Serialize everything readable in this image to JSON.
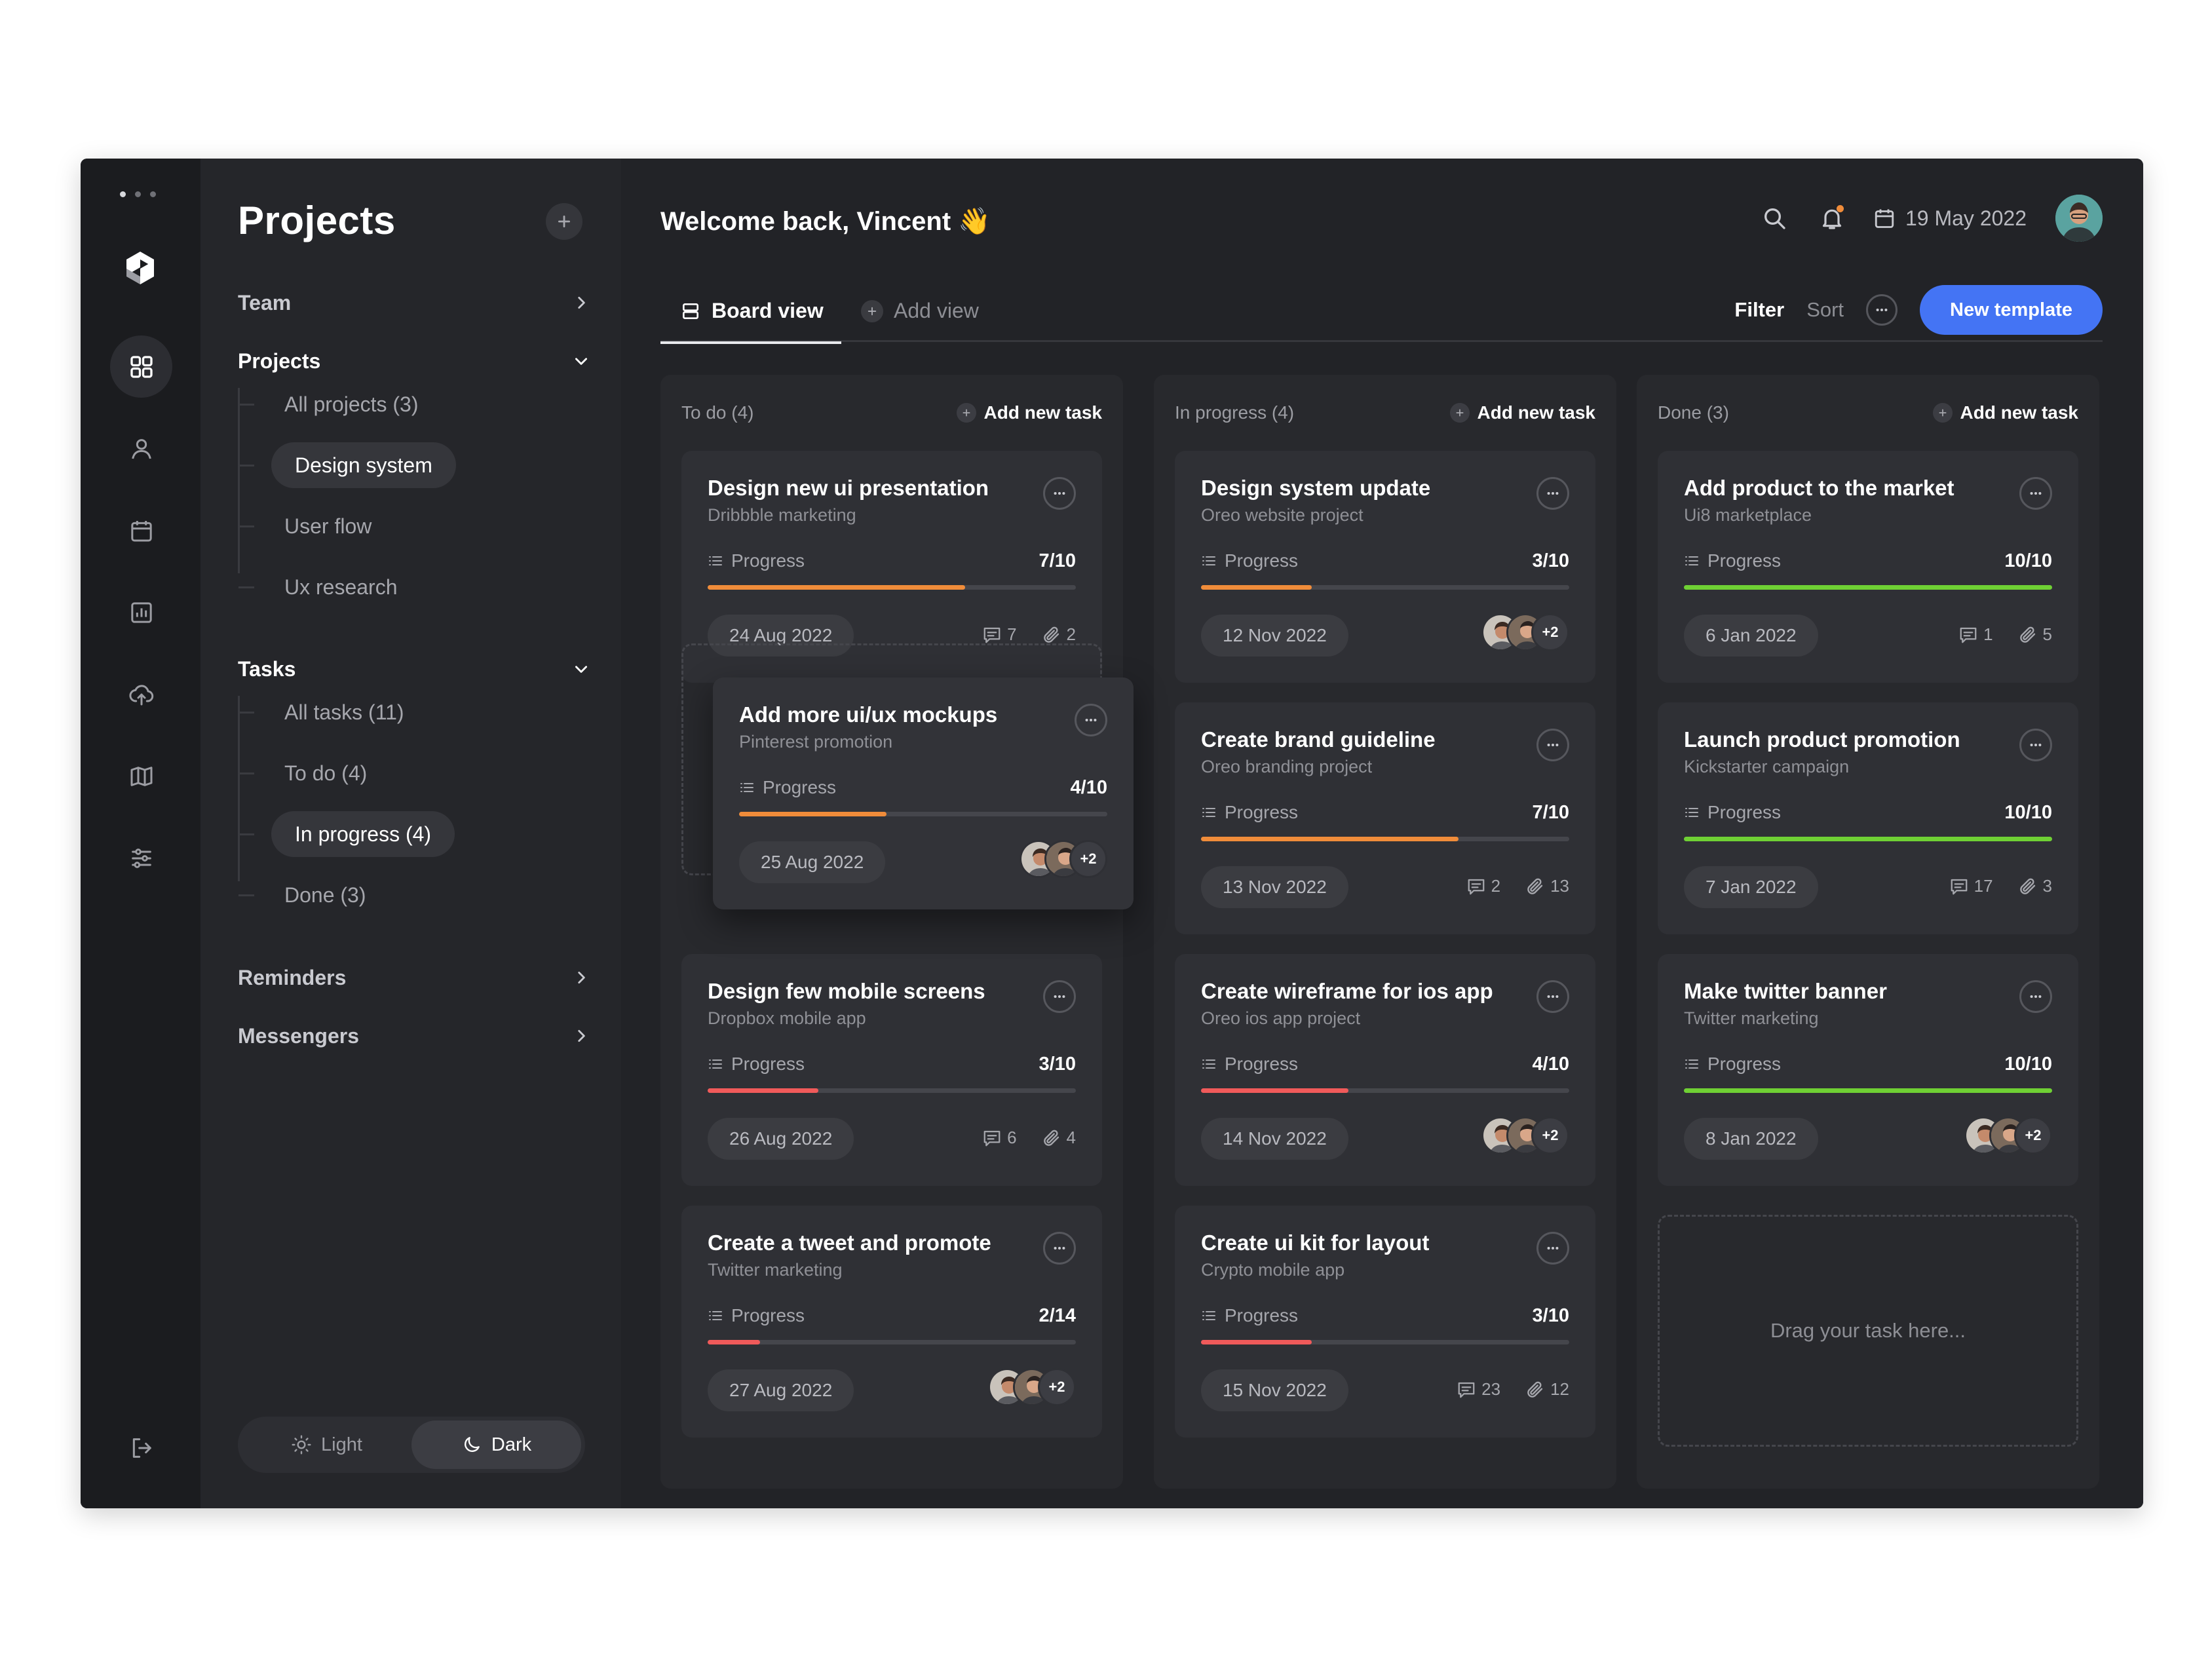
{
  "app": {
    "title": "Projects"
  },
  "colors": {
    "accent": "#4474f4",
    "orange": "#f08c3a",
    "red": "#f05a5a",
    "green": "#6fd034"
  },
  "sidebar": {
    "title": "Projects",
    "sections": {
      "team": "Team",
      "projects": "Projects",
      "tasks": "Tasks",
      "reminders": "Reminders",
      "messengers": "Messengers"
    },
    "project_items": [
      "All projects (3)",
      "Design system",
      "User flow",
      "Ux research"
    ],
    "task_items": [
      "All tasks (11)",
      "To do (4)",
      "In progress (4)",
      "Done (3)"
    ],
    "theme": {
      "light": "Light",
      "dark": "Dark",
      "selected": "Dark"
    }
  },
  "header": {
    "welcome": "Welcome back, Vincent 👋",
    "date": "19 May 2022"
  },
  "tabs": {
    "board": "Board view",
    "add": "Add view"
  },
  "toolbar": {
    "filter": "Filter",
    "sort": "Sort",
    "new_template": "New template"
  },
  "columns": [
    {
      "title": "To do (4)",
      "add": "Add new task",
      "cards": [
        {
          "title": "Design new ui presentation",
          "sub": "Dribbble marketing",
          "progress_label": "Progress",
          "progress": "7/10",
          "date": "24 Aug 2022",
          "comments": "7",
          "attachments": "2"
        },
        {
          "title": "Add more ui/ux mockups",
          "sub": "Pinterest promotion",
          "progress_label": "Progress",
          "progress": "4/10",
          "date": "25 Aug 2022",
          "more_people": "+2"
        },
        {
          "title": "Design few mobile screens",
          "sub": "Dropbox mobile app",
          "progress_label": "Progress",
          "progress": "3/10",
          "date": "26 Aug 2022",
          "comments": "6",
          "attachments": "4"
        },
        {
          "title": "Create a tweet and promote",
          "sub": "Twitter marketing",
          "progress_label": "Progress",
          "progress": "2/14",
          "date": "27 Aug 2022",
          "more_people": "+2"
        }
      ]
    },
    {
      "title": "In progress (4)",
      "add": "Add new task",
      "cards": [
        {
          "title": "Design system update",
          "sub": "Oreo website project",
          "progress_label": "Progress",
          "progress": "3/10",
          "date": "12 Nov 2022",
          "more_people": "+2"
        },
        {
          "title": "Create brand guideline",
          "sub": "Oreo branding project",
          "progress_label": "Progress",
          "progress": "7/10",
          "date": "13 Nov 2022",
          "comments": "2",
          "attachments": "13"
        },
        {
          "title": "Create wireframe for ios app",
          "sub": "Oreo ios app project",
          "progress_label": "Progress",
          "progress": "4/10",
          "date": "14 Nov 2022",
          "more_people": "+2"
        },
        {
          "title": "Create ui kit for layout",
          "sub": "Crypto mobile app",
          "progress_label": "Progress",
          "progress": "3/10",
          "date": "15 Nov 2022",
          "comments": "23",
          "attachments": "12"
        }
      ]
    },
    {
      "title": "Done (3)",
      "add": "Add new task",
      "cards": [
        {
          "title": "Add product to the market",
          "sub": "Ui8 marketplace",
          "progress_label": "Progress",
          "progress": "10/10",
          "date": "6 Jan 2022",
          "comments": "1",
          "attachments": "5"
        },
        {
          "title": "Launch product promotion",
          "sub": "Kickstarter campaign",
          "progress_label": "Progress",
          "progress": "10/10",
          "date": "7 Jan 2022",
          "comments": "17",
          "attachments": "3"
        },
        {
          "title": "Make twitter banner",
          "sub": "Twitter marketing",
          "progress_label": "Progress",
          "progress": "10/10",
          "date": "8 Jan 2022",
          "more_people": "+2"
        }
      ],
      "drop_hint": "Drag your task here..."
    }
  ]
}
